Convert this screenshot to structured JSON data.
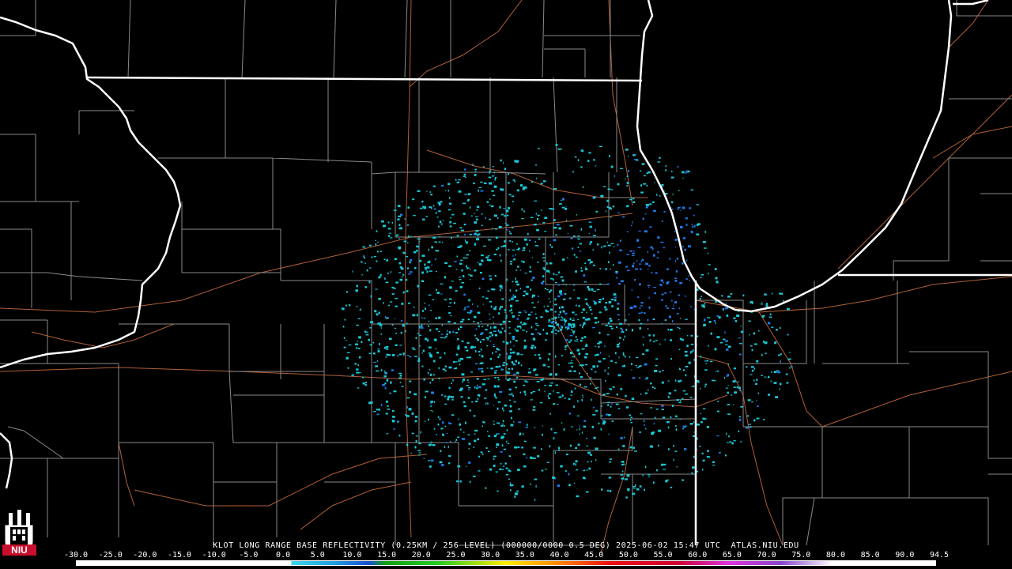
{
  "product": {
    "caption": "KLOT LONG RANGE BASE REFLECTIVITY (0.25KM / 256 LEVEL) (000000/0000 0.5 DEG) 2025-06-02 15:47 UTC  ATLAS.NIU.EDU"
  },
  "scale": {
    "ticks": [
      "-30.0",
      "-25.0",
      "-20.0",
      "-15.0",
      "-10.0",
      "-5.0",
      "0.0",
      "5.0",
      "10.0",
      "15.0",
      "20.0",
      "25.0",
      "30.0",
      "35.0",
      "40.0",
      "45.0",
      "50.0",
      "55.0",
      "60.0",
      "65.0",
      "70.0",
      "75.0",
      "80.0",
      "85.0",
      "90.0",
      "94.5"
    ],
    "gradient": [
      [
        "#ffffff",
        0
      ],
      [
        "#ffffff",
        25
      ],
      [
        "#3bd6e8",
        25
      ],
      [
        "#1e9fe0",
        30
      ],
      [
        "#1a4fd0",
        34
      ],
      [
        "#10a010",
        36
      ],
      [
        "#22cc22",
        42
      ],
      [
        "#ffee00",
        50
      ],
      [
        "#ff8800",
        56
      ],
      [
        "#ee1111",
        62
      ],
      [
        "#cc0033",
        70
      ],
      [
        "#dd33dd",
        76
      ],
      [
        "#8844cc",
        82
      ],
      [
        "#ffffff",
        88
      ],
      [
        "#ffffff",
        100
      ]
    ]
  },
  "logo": {
    "text": "NIU"
  },
  "colors": {
    "background": "#000000",
    "state_border": "#ffffff",
    "county_border": "#8a8a8a",
    "highway": "#b06038",
    "echo_primary": "#19c8d8",
    "echo_secondary": "#1f78e8"
  }
}
